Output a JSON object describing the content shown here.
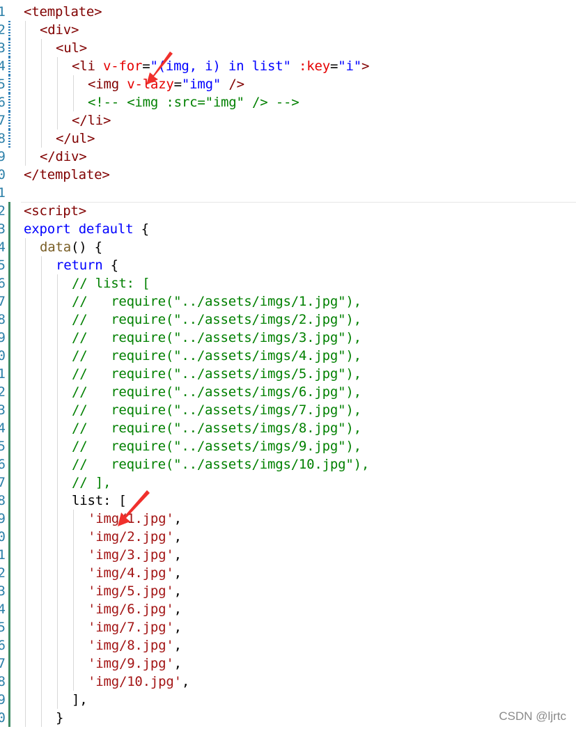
{
  "editor": {
    "lines": [
      {
        "num": "1",
        "bar": "",
        "indent": 0,
        "tokens": [
          [
            "punct",
            "<"
          ],
          [
            "tag",
            "template"
          ],
          [
            "punct",
            ">"
          ]
        ]
      },
      {
        "num": "2",
        "bar": "modified",
        "indent": 1,
        "tokens": [
          [
            "punct",
            "<"
          ],
          [
            "tag",
            "div"
          ],
          [
            "punct",
            ">"
          ]
        ]
      },
      {
        "num": "3",
        "bar": "modified",
        "indent": 2,
        "tokens": [
          [
            "punct",
            "<"
          ],
          [
            "tag",
            "ul"
          ],
          [
            "punct",
            ">"
          ]
        ]
      },
      {
        "num": "4",
        "bar": "modified",
        "indent": 3,
        "tokens": [
          [
            "punct",
            "<"
          ],
          [
            "tag",
            "li"
          ],
          [
            "plain",
            " "
          ],
          [
            "attr",
            "v-for"
          ],
          [
            "plain",
            "="
          ],
          [
            "str",
            "\"(img, i) in list\""
          ],
          [
            "plain",
            " "
          ],
          [
            "attr",
            ":key"
          ],
          [
            "plain",
            "="
          ],
          [
            "str",
            "\"i\""
          ],
          [
            "punct",
            ">"
          ]
        ]
      },
      {
        "num": "5",
        "bar": "modified",
        "indent": 4,
        "tokens": [
          [
            "punct",
            "<"
          ],
          [
            "tag",
            "img"
          ],
          [
            "plain",
            " "
          ],
          [
            "attr",
            "v-lazy"
          ],
          [
            "plain",
            "="
          ],
          [
            "str",
            "\"img\""
          ],
          [
            "plain",
            " "
          ],
          [
            "punct",
            "/>"
          ]
        ]
      },
      {
        "num": "6",
        "bar": "modified",
        "indent": 4,
        "tokens": [
          [
            "comment",
            "<!-- <img :src=\"img\" /> -->"
          ]
        ]
      },
      {
        "num": "7",
        "bar": "modified",
        "indent": 3,
        "tokens": [
          [
            "punct",
            "</"
          ],
          [
            "tag",
            "li"
          ],
          [
            "punct",
            ">"
          ]
        ]
      },
      {
        "num": "8",
        "bar": "modified",
        "indent": 2,
        "tokens": [
          [
            "punct",
            "</"
          ],
          [
            "tag",
            "ul"
          ],
          [
            "punct",
            ">"
          ]
        ]
      },
      {
        "num": "9",
        "bar": "",
        "indent": 1,
        "tokens": [
          [
            "punct",
            "</"
          ],
          [
            "tag",
            "div"
          ],
          [
            "punct",
            ">"
          ]
        ]
      },
      {
        "num": "0",
        "bar": "",
        "indent": 0,
        "tokens": [
          [
            "punct",
            "</"
          ],
          [
            "tag",
            "template"
          ],
          [
            "punct",
            ">"
          ]
        ]
      },
      {
        "num": "1",
        "bar": "",
        "indent": 0,
        "tokens": []
      },
      {
        "num": "2",
        "bar": "added",
        "indent": 0,
        "tokens": [
          [
            "punct",
            "<"
          ],
          [
            "tag",
            "script"
          ],
          [
            "punct",
            ">"
          ]
        ]
      },
      {
        "num": "3",
        "bar": "added",
        "indent": 0,
        "tokens": [
          [
            "kw",
            "export"
          ],
          [
            "plain",
            " "
          ],
          [
            "kw",
            "default"
          ],
          [
            "plain",
            " {"
          ]
        ]
      },
      {
        "num": "4",
        "bar": "added",
        "indent": 1,
        "tokens": [
          [
            "fn",
            "data"
          ],
          [
            "plain",
            "() {"
          ]
        ]
      },
      {
        "num": "5",
        "bar": "added",
        "indent": 2,
        "tokens": [
          [
            "kw",
            "return"
          ],
          [
            "plain",
            " {"
          ]
        ]
      },
      {
        "num": "6",
        "bar": "added",
        "indent": 3,
        "tokens": [
          [
            "comment",
            "// list: ["
          ]
        ]
      },
      {
        "num": "7",
        "bar": "added",
        "indent": 3,
        "tokens": [
          [
            "comment",
            "//   require(\"../assets/imgs/1.jpg\"),"
          ]
        ]
      },
      {
        "num": "8",
        "bar": "added",
        "indent": 3,
        "tokens": [
          [
            "comment",
            "//   require(\"../assets/imgs/2.jpg\"),"
          ]
        ]
      },
      {
        "num": "9",
        "bar": "added",
        "indent": 3,
        "tokens": [
          [
            "comment",
            "//   require(\"../assets/imgs/3.jpg\"),"
          ]
        ]
      },
      {
        "num": "0",
        "bar": "added",
        "indent": 3,
        "tokens": [
          [
            "comment",
            "//   require(\"../assets/imgs/4.jpg\"),"
          ]
        ]
      },
      {
        "num": "1",
        "bar": "added",
        "indent": 3,
        "tokens": [
          [
            "comment",
            "//   require(\"../assets/imgs/5.jpg\"),"
          ]
        ]
      },
      {
        "num": "2",
        "bar": "added",
        "indent": 3,
        "tokens": [
          [
            "comment",
            "//   require(\"../assets/imgs/6.jpg\"),"
          ]
        ]
      },
      {
        "num": "3",
        "bar": "added",
        "indent": 3,
        "tokens": [
          [
            "comment",
            "//   require(\"../assets/imgs/7.jpg\"),"
          ]
        ]
      },
      {
        "num": "4",
        "bar": "added",
        "indent": 3,
        "tokens": [
          [
            "comment",
            "//   require(\"../assets/imgs/8.jpg\"),"
          ]
        ]
      },
      {
        "num": "5",
        "bar": "added",
        "indent": 3,
        "tokens": [
          [
            "comment",
            "//   require(\"../assets/imgs/9.jpg\"),"
          ]
        ]
      },
      {
        "num": "6",
        "bar": "added",
        "indent": 3,
        "tokens": [
          [
            "comment",
            "//   require(\"../assets/imgs/10.jpg\"),"
          ]
        ]
      },
      {
        "num": "7",
        "bar": "added",
        "indent": 3,
        "tokens": [
          [
            "comment",
            "// ],"
          ]
        ]
      },
      {
        "num": "8",
        "bar": "added",
        "indent": 3,
        "tokens": [
          [
            "plain",
            "list: ["
          ]
        ]
      },
      {
        "num": "9",
        "bar": "added",
        "indent": 4,
        "tokens": [
          [
            "sstr",
            "'img/1.jpg'"
          ],
          [
            "plain",
            ","
          ]
        ]
      },
      {
        "num": "0",
        "bar": "added",
        "indent": 4,
        "tokens": [
          [
            "sstr",
            "'img/2.jpg'"
          ],
          [
            "plain",
            ","
          ]
        ]
      },
      {
        "num": "1",
        "bar": "added",
        "indent": 4,
        "tokens": [
          [
            "sstr",
            "'img/3.jpg'"
          ],
          [
            "plain",
            ","
          ]
        ]
      },
      {
        "num": "2",
        "bar": "added",
        "indent": 4,
        "tokens": [
          [
            "sstr",
            "'img/4.jpg'"
          ],
          [
            "plain",
            ","
          ]
        ]
      },
      {
        "num": "3",
        "bar": "added",
        "indent": 4,
        "tokens": [
          [
            "sstr",
            "'img/5.jpg'"
          ],
          [
            "plain",
            ","
          ]
        ]
      },
      {
        "num": "4",
        "bar": "added",
        "indent": 4,
        "tokens": [
          [
            "sstr",
            "'img/6.jpg'"
          ],
          [
            "plain",
            ","
          ]
        ]
      },
      {
        "num": "5",
        "bar": "added",
        "indent": 4,
        "tokens": [
          [
            "sstr",
            "'img/7.jpg'"
          ],
          [
            "plain",
            ","
          ]
        ]
      },
      {
        "num": "6",
        "bar": "added",
        "indent": 4,
        "tokens": [
          [
            "sstr",
            "'img/8.jpg'"
          ],
          [
            "plain",
            ","
          ]
        ]
      },
      {
        "num": "7",
        "bar": "added",
        "indent": 4,
        "tokens": [
          [
            "sstr",
            "'img/9.jpg'"
          ],
          [
            "plain",
            ","
          ]
        ]
      },
      {
        "num": "8",
        "bar": "added",
        "indent": 4,
        "tokens": [
          [
            "sstr",
            "'img/10.jpg'"
          ],
          [
            "plain",
            ","
          ]
        ]
      },
      {
        "num": "9",
        "bar": "added",
        "indent": 3,
        "tokens": [
          [
            "plain",
            "],"
          ]
        ]
      },
      {
        "num": "0",
        "bar": "added",
        "indent": 2,
        "tokens": [
          [
            "plain",
            "}"
          ]
        ]
      }
    ],
    "colors": {
      "punct": "#800000",
      "tag": "#800000",
      "attr": "#e50000",
      "str": "#0000ff",
      "kw": "#0000ff",
      "fn": "#795e26",
      "comment": "#008000",
      "sstr": "#a31515",
      "plain": "#000000",
      "arrow": "#f0302c"
    }
  },
  "annotations": {
    "arrows": [
      {
        "name": "red-arrow-icon",
        "target": "v-lazy"
      },
      {
        "name": "red-arrow-icon",
        "target": "img/1.jpg"
      }
    ]
  },
  "watermark": {
    "text": "CSDN @ljrtc"
  }
}
